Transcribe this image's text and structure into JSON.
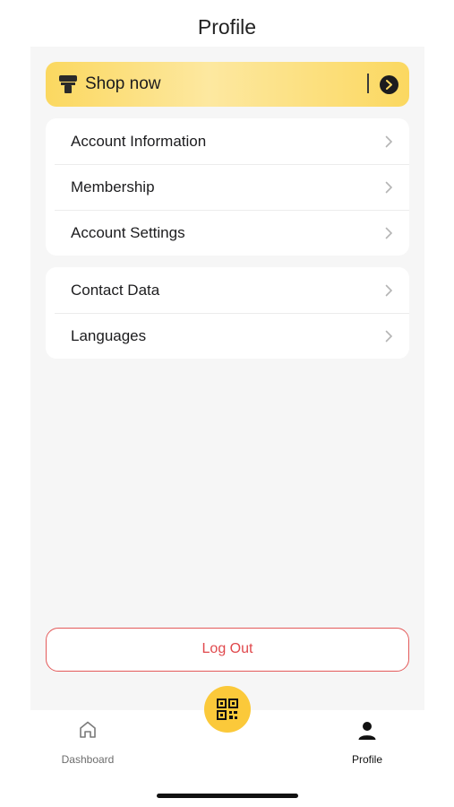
{
  "header": {
    "title": "Profile"
  },
  "shop_banner": {
    "label": "Shop now",
    "icon": "storefront-icon",
    "action_icon": "arrow-right-circle-icon"
  },
  "menu_groups": [
    {
      "items": [
        {
          "label": "Account Information"
        },
        {
          "label": "Membership"
        },
        {
          "label": "Account Settings"
        }
      ]
    },
    {
      "items": [
        {
          "label": "Contact Data"
        },
        {
          "label": "Languages"
        }
      ]
    }
  ],
  "logout": {
    "label": "Log Out",
    "color": "#e0484c"
  },
  "tabbar": {
    "tabs": [
      {
        "label": "Dashboard",
        "icon": "home-icon",
        "active": false
      },
      {
        "label": "Profile",
        "icon": "person-icon",
        "active": true
      }
    ],
    "center_button_icon": "qr-code-icon"
  },
  "colors": {
    "accent": "#fbc93a",
    "banner": "#fbd860",
    "background": "#f6f6f6"
  }
}
